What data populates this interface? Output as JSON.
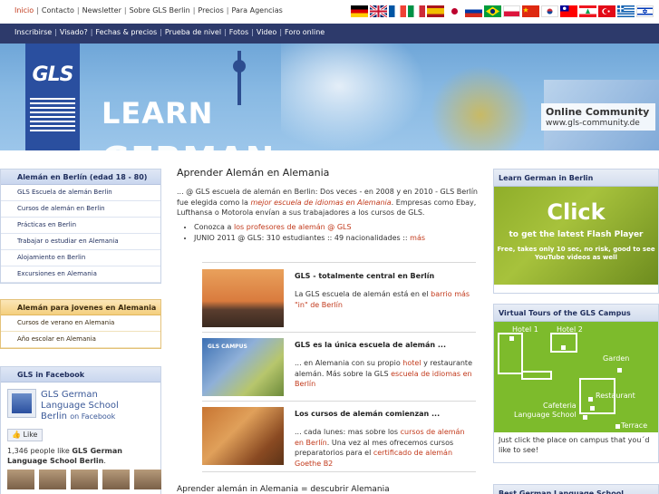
{
  "top_nav": {
    "items": [
      "Inicio",
      "Contacto",
      "Newsletter",
      "Sobre GLS Berlin",
      "Precios",
      "Para Agencias"
    ],
    "active_index": 0
  },
  "flags": [
    "german-flag",
    "uk-flag",
    "french-flag",
    "italian-flag",
    "spanish-flag",
    "japanese-flag",
    "russian-flag",
    "brazilian-flag",
    "polish-flag",
    "chinese-flag",
    "korean-flag",
    "taiwanese-flag",
    "lebanese-flag",
    "turkish-flag",
    "greek-flag",
    "israeli-flag"
  ],
  "sub_nav": {
    "items": [
      "Inscribirse",
      "Visado?",
      "Fechas & precios",
      "Prueba de nivel",
      "Fotos",
      "Video",
      "Foro online"
    ]
  },
  "banner": {
    "logo": "GLS",
    "learn": "LEARN",
    "german": "GERMAN",
    "community_title": "Online Community",
    "community_url": "www.gls-community.de"
  },
  "left": {
    "box1": {
      "heading": "Alemán en Berlín (edad 18 - 80)",
      "items": [
        "GLS Escuela de alemán Berlin",
        "Cursos de alemán en Berlin",
        "Prácticas en Berlin",
        "Trabajar o estudiar en Alemania",
        "Alojamiento en Berlin",
        "Excursiones en Alemania"
      ]
    },
    "box2": {
      "heading": "Alemán para jovenes en Alemania",
      "items": [
        "Cursos de verano en Alemania",
        "Año escolar en Alemania"
      ]
    },
    "facebook": {
      "heading": "GLS in Facebook",
      "page_name": "GLS German Language School Berlin",
      "on_facebook": "on Facebook",
      "like_label": "Like",
      "people_count": "1,346 people like",
      "people_page": "GLS German Language School Berlin",
      "people_end": "."
    }
  },
  "main": {
    "title": "Aprender Alemán en Alemania",
    "intro_before": "... @ GLS escuela de alemán en Berlin: Dos veces - en 2008 y en 2010 - GLS Berlín fue elegida como la ",
    "intro_link": "mejor escuela de idiomas en Alemania",
    "intro_after": ". Empresas como Ebay, Lufthansa o Motorola envían a sus trabajadores a los cursos de GLS.",
    "bullet1_before": "Conozca a ",
    "bullet1_link": "los profesores de alemán @ GLS",
    "bullet2_before": "JUNIO 2011 @ GLS: 310 estudiantes :: 49 nacionalidades :: ",
    "bullet2_link": "más",
    "articles": [
      {
        "title": "GLS - totalmente central en Berlín",
        "text_before": "La GLS escuela de alemán está en el ",
        "link": "barrio más \"in\" de Berlín",
        "text_after": ""
      },
      {
        "title": "GLS es la única escuela de alemán ...",
        "pic_label": "GLS CAMPUS",
        "text_before": "... en Alemania con su propio ",
        "link": "hotel",
        "text_mid": " y restaurante alemán. Más sobre la GLS ",
        "link2": "escuela de idiomas en Berlín",
        "text_after": ""
      },
      {
        "title": "Los cursos de alemán comienzan ...",
        "text_before": "... cada lunes: mas sobre los ",
        "link": "cursos de alemán en Berlín",
        "text_mid": ". Una vez al mes ofrecemos cursos preparatorios para el ",
        "link2": "certificado de alemán Goethe B2",
        "text_after": ""
      }
    ],
    "bottom_title": "Aprender alemán in Alemania = descubrir Alemania"
  },
  "right": {
    "learn_box": {
      "heading": "Learn German in Berlin",
      "click": "Click",
      "flash": "to get the latest Flash Player",
      "small": "Free, takes only 10 sec, no risk, good to see YouTube videos as well"
    },
    "tours_box": {
      "heading": "Virtual Tours of the GLS Campus",
      "labels": [
        "Hotel 1",
        "Hotel 2",
        "Garden",
        "Restaurant",
        "Cafeteria",
        "Language School",
        "Terrace"
      ],
      "caption": "Just click the place on campus that you´d like to see!"
    },
    "best_box": {
      "heading": "Best German Language School"
    }
  }
}
